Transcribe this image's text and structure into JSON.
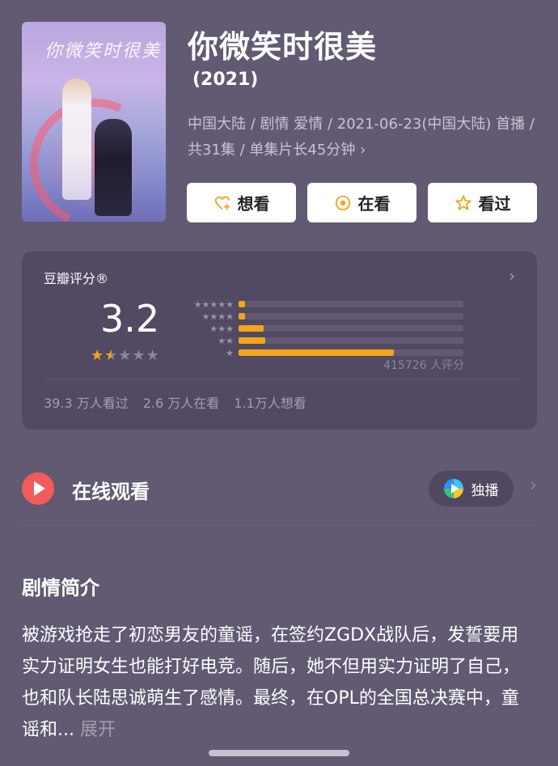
{
  "movie": {
    "title": "你微笑时很美",
    "year": "(2021)",
    "meta": "中国大陆 / 剧情 爱情 / 2021-06-23(中国大陆) 首播 / 共31集 / 单集片长45分钟",
    "poster_text": "你微笑时很美"
  },
  "actions": [
    {
      "label": "想看",
      "icon": "heart-plus-icon"
    },
    {
      "label": "在看",
      "icon": "target-icon"
    },
    {
      "label": "看过",
      "icon": "star-outline-icon"
    }
  ],
  "rating": {
    "section_title": "豆瓣评分®",
    "score": "3.2",
    "stars": {
      "value": 1.5,
      "max": 5
    },
    "distribution": [
      {
        "stars": 5,
        "fraction": 0.03
      },
      {
        "stars": 4,
        "fraction": 0.03
      },
      {
        "stars": 3,
        "fraction": 0.11
      },
      {
        "stars": 2,
        "fraction": 0.12
      },
      {
        "stars": 1,
        "fraction": 0.69
      }
    ],
    "count_text": "415726 人评分",
    "stats": [
      "39.3 万人看过",
      "2.6 万人在看",
      "1.1万人想看"
    ]
  },
  "online": {
    "title": "在线观看",
    "platform_label": "独播",
    "play_icon": "play-circle-icon",
    "platform_icon": "video-platform-logo-icon"
  },
  "synopsis": {
    "title": "剧情简介",
    "text": "被游戏抢走了初恋男友的童谣，在签约ZGDX战队后，发誓要用实力证明女生也能打好电竞。随后，她不但用实力证明了自己，也和队长陆思诚萌生了感情。最终，在OPL的全国总决赛中，童谣和...",
    "expand_label": "展开"
  },
  "colors": {
    "accent": "#f4a51a",
    "play": "#f25b5b",
    "background": "#615a72",
    "card": "#514a62"
  }
}
